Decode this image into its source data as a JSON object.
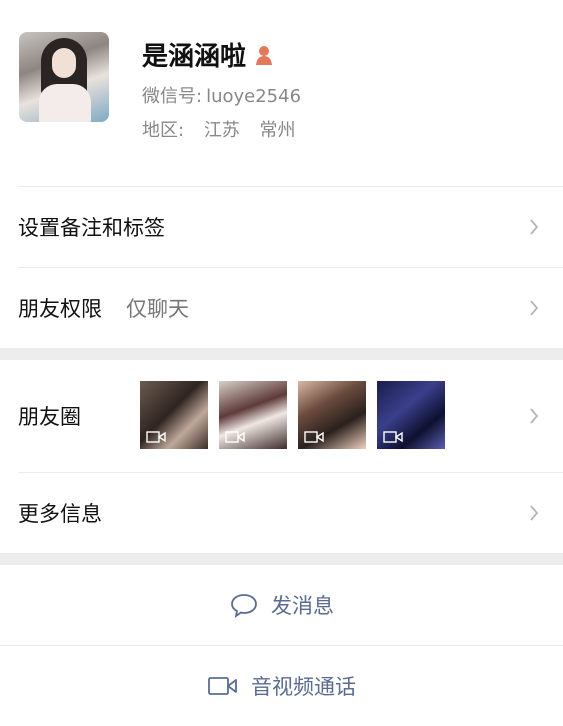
{
  "profile": {
    "name": "是涵涵啦",
    "wechat_id_label": "微信号:",
    "wechat_id": "luoye2546",
    "region_label": "地区:",
    "region_province": "江苏",
    "region_city": "常州",
    "gender_icon": "female-person-icon",
    "gender_icon_color": "#e2795b"
  },
  "rows": {
    "remark_label": "设置备注和标签",
    "permission_label": "朋友权限",
    "permission_value": "仅聊天",
    "moments_label": "朋友圈",
    "more_info_label": "更多信息"
  },
  "moments_thumbs": [
    "video-thumbnail",
    "video-thumbnail",
    "video-thumbnail",
    "video-thumbnail"
  ],
  "actions": {
    "message_label": "发消息",
    "call_label": "音视频通话",
    "accent_color": "#5b6b92"
  }
}
